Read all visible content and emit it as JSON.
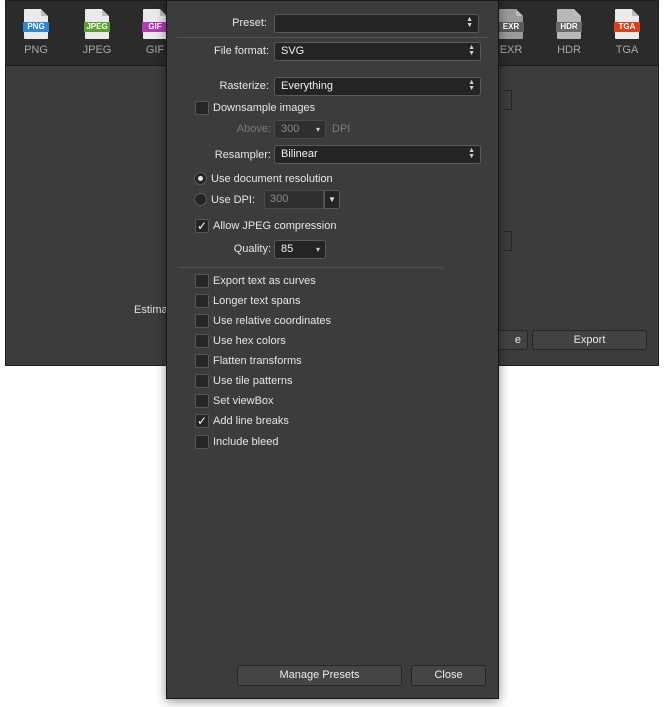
{
  "formats": [
    {
      "name": "PNG",
      "tag": "PNG",
      "color": "#2f86d8"
    },
    {
      "name": "JPEG",
      "tag": "JPEG",
      "color": "#5aa132"
    },
    {
      "name": "GIF",
      "tag": "GIF",
      "color": "#b23cb5"
    },
    {
      "name": "EXR",
      "tag": "EXR",
      "color": "#5a5a5a"
    },
    {
      "name": "HDR",
      "tag": "HDR",
      "color": "#6a6a6a"
    },
    {
      "name": "TGA",
      "tag": "TGA",
      "color": "#d8431c"
    }
  ],
  "back": {
    "estimate_label": "Estima",
    "cancel_stub": "e",
    "export_label": "Export"
  },
  "panel": {
    "preset_label": "Preset:",
    "preset_value": "",
    "file_format_label": "File format:",
    "file_format_value": "SVG",
    "rasterize_label": "Rasterize:",
    "rasterize_value": "Everything",
    "downsample_label": "Downsample images",
    "downsample_checked": false,
    "above_label": "Above:",
    "above_value": "300",
    "above_unit": "DPI",
    "resampler_label": "Resampler:",
    "resampler_value": "Bilinear",
    "use_doc_res_label": "Use document resolution",
    "use_dpi_label": "Use DPI:",
    "dpi_value": "300",
    "allow_jpeg_label": "Allow JPEG compression",
    "allow_jpeg_checked": true,
    "quality_label": "Quality:",
    "quality_value": "85",
    "options": [
      {
        "label": "Export text as curves",
        "checked": false
      },
      {
        "label": "Longer text spans",
        "checked": false
      },
      {
        "label": "Use relative coordinates",
        "checked": false
      },
      {
        "label": "Use hex colors",
        "checked": false
      },
      {
        "label": "Flatten transforms",
        "checked": false
      },
      {
        "label": "Use tile patterns",
        "checked": false
      },
      {
        "label": "Set viewBox",
        "checked": false
      },
      {
        "label": "Add line breaks",
        "checked": true
      },
      {
        "label": "Include bleed",
        "checked": false
      }
    ],
    "manage_presets_label": "Manage Presets",
    "close_label": "Close"
  },
  "check_glyph": "✓",
  "stepper_glyph": "▲▼",
  "dropdown_glyph": "▼"
}
